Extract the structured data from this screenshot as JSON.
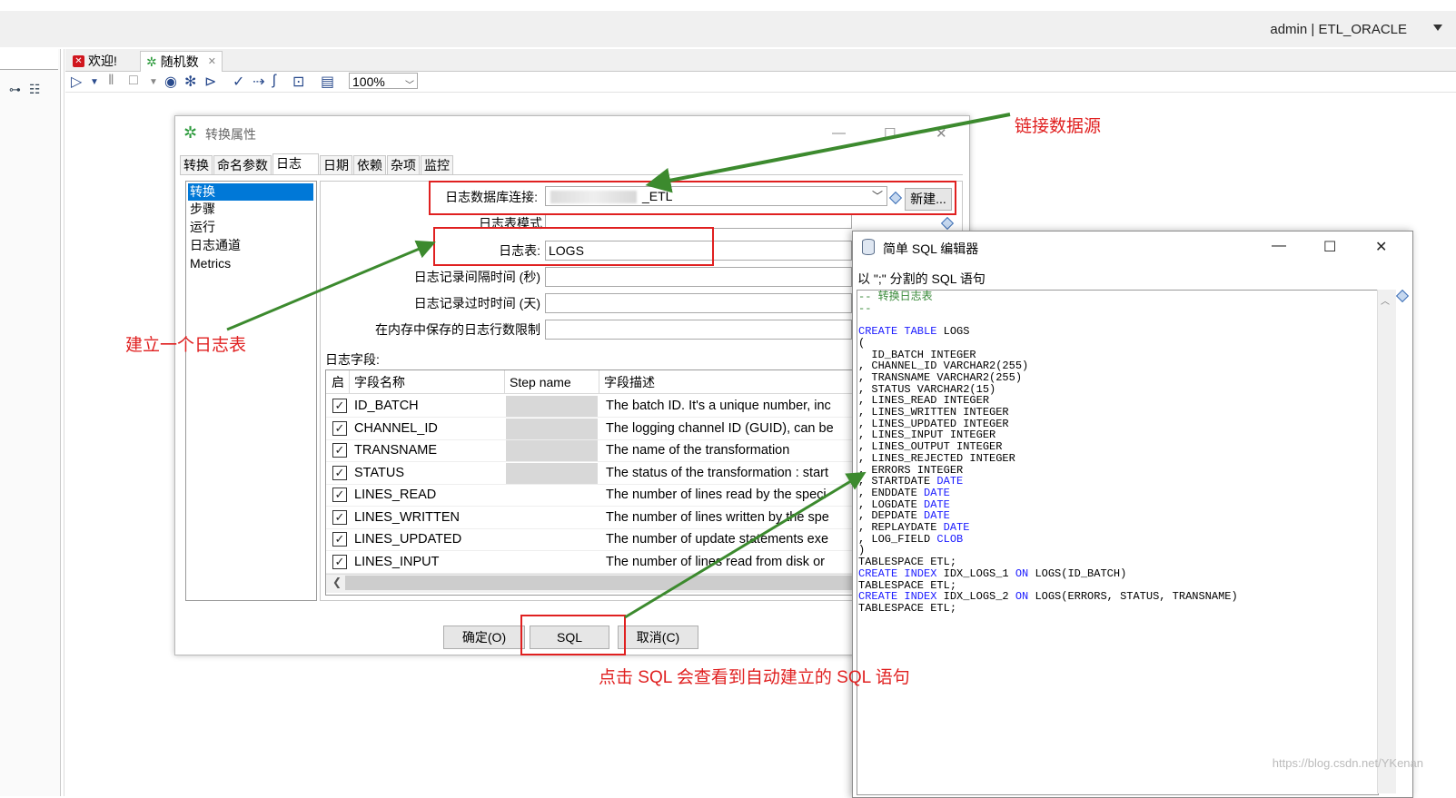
{
  "header": {
    "user_info": "admin  |  ETL_ORACLE"
  },
  "tabs": [
    {
      "label": "欢迎!"
    },
    {
      "label": "随机数"
    }
  ],
  "toolbar": {
    "zoom": "100%"
  },
  "dialog": {
    "title": "转换属性",
    "tabs": [
      "转换",
      "命名参数",
      "日志",
      "日期",
      "依赖",
      "杂项",
      "监控"
    ],
    "active_tab": "日志",
    "log_types": [
      "转换",
      "步骤",
      "运行",
      "日志通道",
      "Metrics"
    ],
    "form": {
      "db_connection_label": "日志数据库连接:",
      "db_connection_value": "_ETL",
      "new_button": "新建...",
      "schema_label": "日志表模式",
      "table_label": "日志表:",
      "table_value": "LOGS",
      "interval_label": "日志记录间隔时间 (秒)",
      "timeout_label": "日志记录过时时间 (天)",
      "max_lines_label": "在内存中保存的日志行数限制"
    },
    "fields_label": "日志字段:",
    "table_headers": [
      "启",
      "字段名称",
      "Step name",
      "字段描述"
    ],
    "fields": [
      {
        "name": "ID_BATCH",
        "desc": "The batch ID. It's a unique number, inc"
      },
      {
        "name": "CHANNEL_ID",
        "desc": "The logging channel ID (GUID), can be"
      },
      {
        "name": "TRANSNAME",
        "desc": "The name of the transformation"
      },
      {
        "name": "STATUS",
        "desc": "The status of the transformation : start"
      },
      {
        "name": "LINES_READ",
        "desc": "The number of lines read by the speci"
      },
      {
        "name": "LINES_WRITTEN",
        "desc": "The number of lines written by the spe"
      },
      {
        "name": "LINES_UPDATED",
        "desc": "The number of update statements exe"
      },
      {
        "name": "LINES_INPUT",
        "desc": "The number of lines read from disk or"
      }
    ],
    "buttons": {
      "ok": "确定(O)",
      "sql": "SQL",
      "cancel": "取消(C)"
    }
  },
  "sql_editor": {
    "title": "简单 SQL 编辑器",
    "subtitle": "以 \";\" 分割的 SQL 语句",
    "comment": "-- 转换日志表",
    "comment_end": "--",
    "create_table_kw": "CREATE TABLE",
    "table_name": " LOGS",
    "open_paren": "(",
    "columns": [
      {
        "name": "  ID_BATCH INTEGER",
        "type": ""
      },
      {
        "name": ", CHANNEL_ID VARCHAR2(255)",
        "type": ""
      },
      {
        "name": ", TRANSNAME VARCHAR2(255)",
        "type": ""
      },
      {
        "name": ", STATUS VARCHAR2(15)",
        "type": ""
      },
      {
        "name": ", LINES_READ INTEGER",
        "type": ""
      },
      {
        "name": ", LINES_WRITTEN INTEGER",
        "type": ""
      },
      {
        "name": ", LINES_UPDATED INTEGER",
        "type": ""
      },
      {
        "name": ", LINES_INPUT INTEGER",
        "type": ""
      },
      {
        "name": ", LINES_OUTPUT INTEGER",
        "type": ""
      },
      {
        "name": ", LINES_REJECTED INTEGER",
        "type": ""
      },
      {
        "name": ", ERRORS INTEGER",
        "type": ""
      },
      {
        "name": ", STARTDATE ",
        "type": "DATE"
      },
      {
        "name": ", ENDDATE ",
        "type": "DATE"
      },
      {
        "name": ", LOGDATE ",
        "type": "DATE"
      },
      {
        "name": ", DEPDATE ",
        "type": "DATE"
      },
      {
        "name": ", REPLAYDATE ",
        "type": "DATE"
      },
      {
        "name": ", LOG_FIELD ",
        "type": "CLOB"
      }
    ],
    "close_paren": ")",
    "tablespace": "TABLESPACE ETL;",
    "index1_kw": "CREATE INDEX",
    "index1_name": " IDX_LOGS_1 ",
    "on_kw": "ON",
    "index1_target": " LOGS(ID_BATCH)",
    "index2_name": " IDX_LOGS_2 ",
    "index2_target": " LOGS(ERRORS, STATUS, TRANSNAME)"
  },
  "annotations": {
    "link_datasource": "链接数据源",
    "create_log_table": "建立一个日志表",
    "click_sql": "点击 SQL 会查看到自动建立的 SQL 语句"
  },
  "watermark": "https://blog.csdn.net/YKenan",
  "colors": {
    "annotation_red": "#e02020",
    "arrow_green": "#3c8a2e",
    "selection_blue": "#0078d7",
    "sql_keyword": "#1a1aff"
  }
}
